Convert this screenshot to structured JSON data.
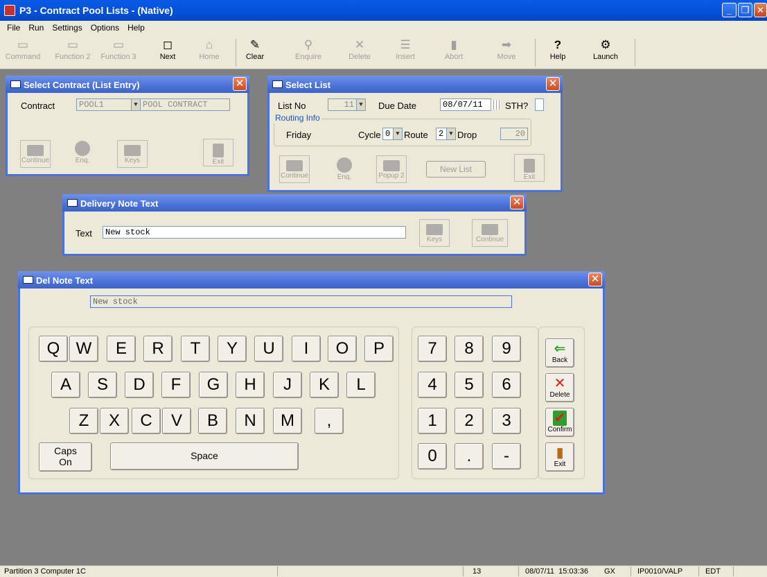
{
  "window": {
    "title": "P3 - Contract Pool Lists - (Native)"
  },
  "menu": [
    "File",
    "Run",
    "Settings",
    "Options",
    "Help"
  ],
  "toolbar": [
    {
      "label": "Command",
      "icon": "f-key-icon",
      "glyph": "▭",
      "enabled": false
    },
    {
      "label": "Function 2",
      "icon": "f-key-icon",
      "glyph": "▭",
      "enabled": false
    },
    {
      "label": "Function 3",
      "icon": "f-key-icon",
      "glyph": "▭",
      "enabled": false
    },
    {
      "label": "Next",
      "icon": "next-page-icon",
      "glyph": "◻",
      "enabled": true
    },
    {
      "label": "Home",
      "icon": "home-icon",
      "glyph": "⌂",
      "enabled": false
    },
    {
      "label": "Clear",
      "icon": "clear-icon",
      "glyph": "✎",
      "enabled": true
    },
    {
      "label": "Enquire",
      "icon": "magnifier-icon",
      "glyph": "⚲",
      "enabled": false
    },
    {
      "label": "Delete",
      "icon": "cross-icon",
      "glyph": "✕",
      "enabled": false
    },
    {
      "label": "Insert",
      "icon": "insert-icon",
      "glyph": "☰",
      "enabled": false
    },
    {
      "label": "Abort",
      "icon": "abort-icon",
      "glyph": "▮",
      "enabled": false
    },
    {
      "label": "Move",
      "icon": "arrow-right-icon",
      "glyph": "➡",
      "enabled": false
    },
    {
      "label": "Help",
      "icon": "help-icon",
      "glyph": "?",
      "enabled": true
    },
    {
      "label": "Launch",
      "icon": "launch-icon",
      "glyph": "⚙",
      "enabled": true
    }
  ],
  "select_contract": {
    "title": "Select Contract (List Entry)",
    "contract_label": "Contract",
    "contract_code": "POOL1",
    "contract_name": "POOL CONTRACT",
    "buttons": [
      "Continue",
      "Enq.",
      "Keys",
      "Exit"
    ]
  },
  "select_list": {
    "title": "Select List",
    "list_no_label": "List No",
    "list_no": "11",
    "due_date_label": "Due Date",
    "due_date": "08/07/11",
    "sth_label": "STH?",
    "routing_label": "Routing Info",
    "day": "Friday",
    "cycle_label": "Cycle",
    "cycle": "0",
    "route_label": "Route",
    "route": "2",
    "drop_label": "Drop",
    "drop": "20",
    "buttons": [
      "Continue",
      "Enq.",
      "Popup 2",
      "Exit"
    ],
    "new_list": "New List"
  },
  "delivery_note": {
    "title": "Delivery Note Text",
    "text_label": "Text",
    "text_value": "New stock",
    "buttons": [
      "Keys",
      "Continue"
    ]
  },
  "del_note_keyboard": {
    "title": "Del Note Text",
    "display": "New stock",
    "row1": [
      "Q",
      "W",
      "E",
      "R",
      "T",
      "Y",
      "U",
      "I",
      "O",
      "P"
    ],
    "row2": [
      "A",
      "S",
      "D",
      "F",
      "G",
      "H",
      "J",
      "K",
      "L"
    ],
    "row3": [
      "Z",
      "X",
      "C",
      "V",
      "B",
      "N",
      "M",
      ","
    ],
    "caps": "Caps On",
    "space": "Space",
    "numpad": [
      "7",
      "8",
      "9",
      "4",
      "5",
      "6",
      "1",
      "2",
      "3",
      "0",
      ".",
      "-"
    ],
    "functions": [
      {
        "label": "Back",
        "icon": "back-arrow-icon",
        "glyph": "⇐",
        "color": "#2e9d2e"
      },
      {
        "label": "Delete",
        "icon": "delete-cross-icon",
        "glyph": "✕",
        "color": "#d81e1e"
      },
      {
        "label": "Confirm",
        "icon": "confirm-check-icon",
        "glyph": "✔",
        "color": "#d81e1e"
      },
      {
        "label": "Exit",
        "icon": "exit-door-icon",
        "glyph": "▮",
        "color": "#b86a1a"
      }
    ]
  },
  "status": {
    "partition": "Partition 3 Computer 1C",
    "num": "13",
    "datetime": "08/07/11  15:03:36",
    "mode": "GX",
    "program": "IP0010/VALP",
    "state": "EDT"
  }
}
